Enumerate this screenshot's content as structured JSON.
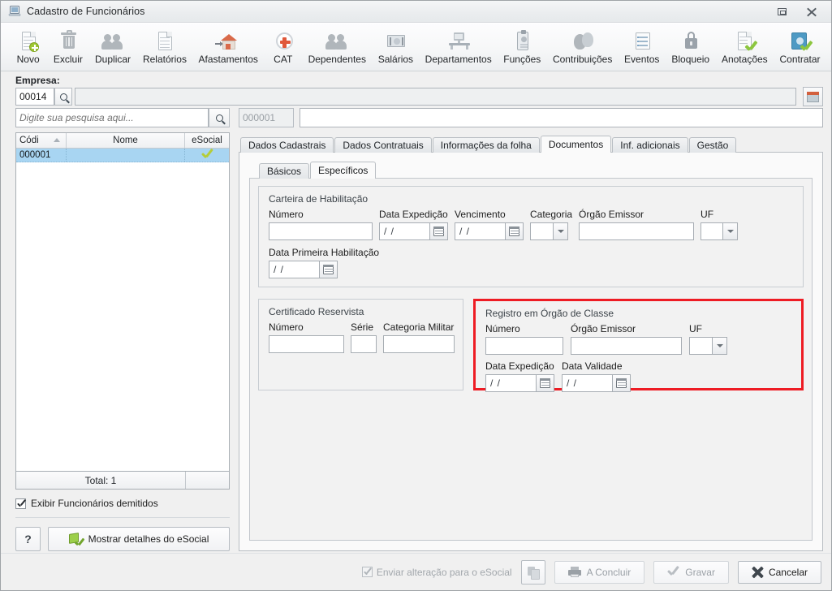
{
  "window": {
    "title": "Cadastro de Funcionários",
    "icon": "app-window-icon",
    "restore_label": "Restaurar",
    "close_label": "Fechar"
  },
  "toolbar": {
    "items": [
      {
        "label": "Novo",
        "icon": "new-document-icon"
      },
      {
        "label": "Excluir",
        "icon": "trash-icon"
      },
      {
        "label": "Duplicar",
        "icon": "people-icon"
      },
      {
        "label": "Relatórios",
        "icon": "report-document-icon"
      },
      {
        "label": "Afastamentos",
        "icon": "leave-house-icon"
      },
      {
        "label": "CAT",
        "icon": "red-cross-icon"
      },
      {
        "label": "Dependentes",
        "icon": "people-icon"
      },
      {
        "label": "Salários",
        "icon": "money-icon"
      },
      {
        "label": "Departamentos",
        "icon": "desk-icon"
      },
      {
        "label": "Funções",
        "icon": "id-badge-icon"
      },
      {
        "label": "Contribuições",
        "icon": "heads-icon"
      },
      {
        "label": "Eventos",
        "icon": "list-icon"
      },
      {
        "label": "Bloqueio",
        "icon": "lock-icon"
      },
      {
        "label": "Anotações",
        "icon": "document-check-icon"
      },
      {
        "label": "Contratar",
        "icon": "hire-check-icon"
      }
    ]
  },
  "empresa": {
    "label": "Empresa:",
    "code_value": "00014",
    "name_value": "",
    "search_icon": "magnifier-icon",
    "picker_icon": "company-store-icon"
  },
  "left_panel": {
    "search": {
      "placeholder": "Digite sua pesquisa aqui...",
      "value": "",
      "icon": "magnifier-icon"
    },
    "grid": {
      "columns": [
        "Códi",
        "Nome",
        "eSocial"
      ],
      "sort_indicator": "sort-ascending-icon",
      "rows": [
        {
          "codigo": "000001",
          "nome": "",
          "esocial": "check-green-icon",
          "selected": true
        }
      ]
    },
    "total_label": "Total: 1",
    "show_dismissed": {
      "label": "Exibir Funcionários demitidos",
      "checked": true
    },
    "help_button": "?",
    "esocial_button": {
      "label": "Mostrar detalhes do eSocial",
      "icon": "esocial-details-icon"
    }
  },
  "record": {
    "code_value": "000001",
    "name_value": ""
  },
  "main_tabs": {
    "items": [
      {
        "label": "Dados Cadastrais",
        "active": false
      },
      {
        "label": "Dados Contratuais",
        "active": false
      },
      {
        "label": "Informações da folha",
        "active": false
      },
      {
        "label": "Documentos",
        "active": true
      },
      {
        "label": "Inf. adicionais",
        "active": false
      },
      {
        "label": "Gestão",
        "active": false
      }
    ]
  },
  "sub_tabs": {
    "items": [
      {
        "label": "Básicos",
        "active": false
      },
      {
        "label": "Específicos",
        "active": true
      }
    ]
  },
  "groups": {
    "habilitacao": {
      "title": "Carteira de Habilitação",
      "fields": [
        {
          "label": "Número",
          "type": "text",
          "value": ""
        },
        {
          "label": "Data Expedição",
          "type": "date",
          "value": "  /  /"
        },
        {
          "label": "Vencimento",
          "type": "date",
          "value": "  /  /"
        },
        {
          "label": "Categoria",
          "type": "combo",
          "value": ""
        },
        {
          "label": "Órgão Emissor",
          "type": "text",
          "value": ""
        },
        {
          "label": "UF",
          "type": "combo",
          "value": ""
        },
        {
          "label": "Data Primeira Habilitação",
          "type": "date",
          "value": "  /  /"
        }
      ]
    },
    "reservista": {
      "title": "Certificado Reservista",
      "fields": [
        {
          "label": "Número",
          "type": "text",
          "value": ""
        },
        {
          "label": "Série",
          "type": "text",
          "value": ""
        },
        {
          "label": "Categoria Militar",
          "type": "text",
          "value": ""
        }
      ]
    },
    "orgao_classe": {
      "title": "Registro em Órgão de Classe",
      "highlight_color": "#ee1c24",
      "fields": [
        {
          "label": "Número",
          "type": "text",
          "value": ""
        },
        {
          "label": "Órgão Emissor",
          "type": "text",
          "value": ""
        },
        {
          "label": "UF",
          "type": "combo",
          "value": ""
        },
        {
          "label": "Data Expedição",
          "type": "date",
          "value": "  /  /"
        },
        {
          "label": "Data Validade",
          "type": "date",
          "value": "  /  /"
        }
      ]
    }
  },
  "footer": {
    "send_esocial": {
      "label": "Enviar alteração para o eSocial",
      "checked": true,
      "disabled": true
    },
    "copy_button_icon": "copy-icon",
    "concluir": {
      "label": "A Concluir",
      "icon": "printer-icon",
      "disabled": true
    },
    "gravar": {
      "label": "Gravar",
      "icon": "check-icon",
      "disabled": true
    },
    "cancelar": {
      "label": "Cancelar",
      "icon": "x-icon",
      "disabled": false
    }
  }
}
